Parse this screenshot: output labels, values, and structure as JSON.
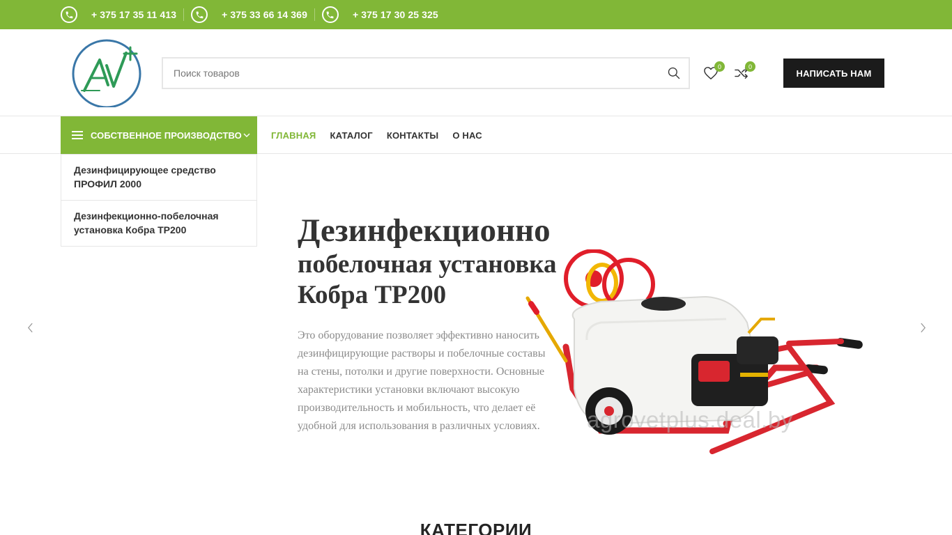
{
  "topbar": {
    "phones": [
      "+ 375 17 35 11 413",
      "+ 375 33 66 14 369",
      "+ 375 17 30 25 325"
    ]
  },
  "header": {
    "search_placeholder": "Поиск товаров",
    "wishlist_count": "0",
    "compare_count": "0",
    "contact_button": "НАПИСАТЬ НАМ"
  },
  "nav": {
    "categories_label": "СОБСТВЕННОЕ ПРОИЗВОДСТВО",
    "menu": [
      {
        "label": "ГЛАВНАЯ",
        "active": true
      },
      {
        "label": "КАТАЛОГ",
        "active": false
      },
      {
        "label": "КОНТАКТЫ",
        "active": false
      },
      {
        "label": "О НАС",
        "active": false
      }
    ]
  },
  "dropdown": {
    "items": [
      {
        "line1": "Дезинфицирующее средство",
        "line2": "ПРОФИЛ 2000"
      },
      {
        "line1": "Дезинфекционно-побелочная",
        "line2": "установка Кобра ТР200"
      }
    ]
  },
  "slide": {
    "title_line1": "Дезинфекционно",
    "title_line2": "побелочная установка",
    "title_line3": "Кобра ТР200",
    "description": "Это оборудование позволяет эффективно наносить дезинфицирующие растворы и побелочные составы на стены, потолки и другие поверхности. Основные характеристики установки включают высокую производительность и мобильность, что делает её удобной для использования в различных условиях.",
    "watermark": "agrovetplus.deal.by"
  },
  "section": {
    "title": "КАТЕГОРИИ"
  },
  "colors": {
    "accent": "#81b737",
    "dark": "#1b1b1b",
    "text": "#333333"
  }
}
